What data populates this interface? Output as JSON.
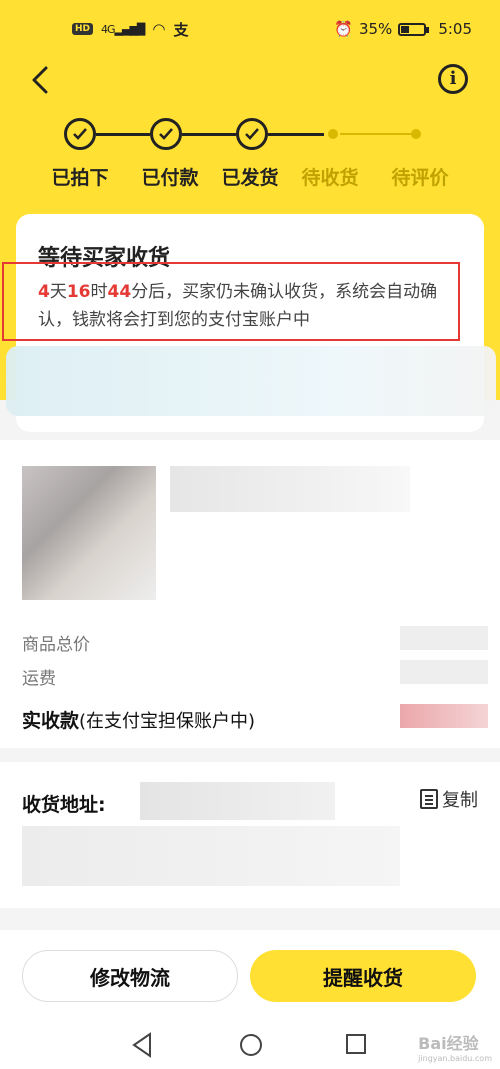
{
  "status_bar": {
    "hd": "HD",
    "signal": "4G",
    "percent": "35%",
    "time": "5:05"
  },
  "colors": {
    "accent": "#ffe033",
    "countdown_red": "#e53935"
  },
  "steps": [
    {
      "label": "已拍下",
      "done": true
    },
    {
      "label": "已付款",
      "done": true
    },
    {
      "label": "已发货",
      "done": true
    },
    {
      "label": "待收货",
      "done": false
    },
    {
      "label": "待评价",
      "done": false
    }
  ],
  "status": {
    "title": "等待买家收货",
    "days": "4",
    "days_unit": "天",
    "hours": "16",
    "hours_unit": "时",
    "minutes": "44",
    "desc_rest": "分后，买家仍未确认收货，系统会自动确认，钱款将会打到您的支付宝账户中"
  },
  "product": {
    "total_label": "商品总价",
    "shipping_label": "运费",
    "received_label": "实收款",
    "received_note": "(在支付宝担保账户中)"
  },
  "address": {
    "label": "收货地址:",
    "copy_label": "复制"
  },
  "actions": {
    "modify_logistics": "修改物流",
    "remind_receipt": "提醒收货"
  },
  "watermark": {
    "text": "Bai经验",
    "sub": "jingyan.baidu.com"
  }
}
